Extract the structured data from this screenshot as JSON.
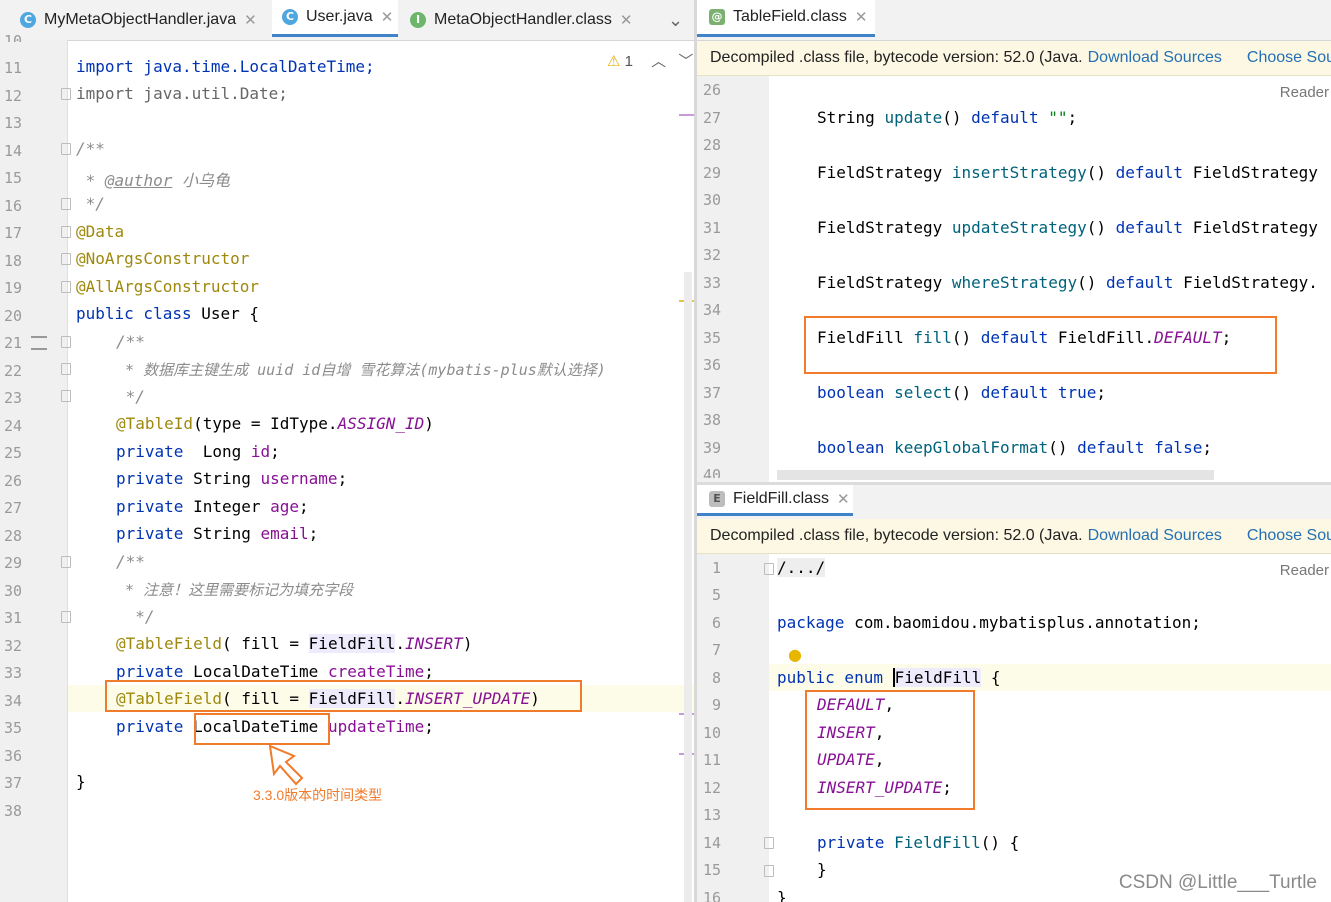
{
  "left": {
    "tabs": [
      {
        "icon": "class-c-icon",
        "label": "MyMetaObjectHandler.java"
      },
      {
        "icon": "class-c-icon",
        "label": "User.java"
      },
      {
        "icon": "interface-i-icon",
        "label": "MetaObjectHandler.class"
      }
    ],
    "warning_count": "1",
    "lines": {
      "l11": "11",
      "l12": "12",
      "l13": "13",
      "l14": "14",
      "l15": "15",
      "l16": "16",
      "l17": "17",
      "l18": "18",
      "l19": "19",
      "l20": "20",
      "l21": "21",
      "l22": "22",
      "l23": "23",
      "l24": "24",
      "l25": "25",
      "l26": "26",
      "l27": "27",
      "l28": "28",
      "l29": "29",
      "l30": "30",
      "l31": "31",
      "l32": "32",
      "l33": "33",
      "l34": "34",
      "l35": "35",
      "l36": "36",
      "l37": "37",
      "l38": "38"
    },
    "code": {
      "import1": "import java.time.LocalDateTime;",
      "import2": "import java.util.Date;",
      "doc_open": "/**",
      "author_prefix": " * ",
      "author_tag": "@author",
      "author_name": " 小乌龟",
      "doc_close": " */",
      "data": "@Data",
      "noargs": "@NoArgsConstructor",
      "allargs": "@AllArgsConstructor",
      "class_kw": "public class",
      "class_name": " User {",
      "c2_open": "/**",
      "c2_line": " * 数据库主键生成 uuid id自增 雪花算法(mybatis-plus默认选择)",
      "c2_close": " */",
      "tableid_ann": "@TableId",
      "tableid_rest": "(type = IdType.",
      "tableid_const": "ASSIGN_ID",
      "tableid_end": ")",
      "f1_kw": "private",
      "f1_type": "  Long ",
      "f1_name": "id",
      "f1_end": ";",
      "f2_kw": "private",
      "f2_type": " String ",
      "f2_name": "username",
      "f2_end": ";",
      "f3_kw": "private",
      "f3_type": " Integer ",
      "f3_name": "age",
      "f3_end": ";",
      "f4_kw": "private",
      "f4_type": " String ",
      "f4_name": "email",
      "f4_end": ";",
      "c3_open": "/**",
      "c3_line": " * 注意！这里需要标记为填充字段",
      "c3_close": "  */",
      "tf1_ann": "@TableField",
      "tf1_mid": "( fill = ",
      "tf1_type": "FieldFill",
      "tf1_dot": ".",
      "tf1_const": "INSERT",
      "tf1_end": ")",
      "f5_kw": "private",
      "f5_type": " LocalDateTime ",
      "f5_name": "createTime",
      "f5_end": ";",
      "tf2_ann": "@TableField",
      "tf2_mid": "( fill = ",
      "tf2_type": "FieldFill",
      "tf2_dot": ".",
      "tf2_const": "INSERT_UPDATE",
      "tf2_end": ")",
      "f6_kw": "private",
      "f6_type": "LocalDateTime",
      "f6_name": " updateTime",
      "f6_end": ";",
      "close": "}"
    },
    "annotation_note": "3.3.0版本的时间类型"
  },
  "right_top": {
    "tab": {
      "icon": "annotation-icon",
      "label": "TableField.class"
    },
    "banner_text": "Decompiled .class file, bytecode version: 52.0 (Java.",
    "download_label": "Download Sources",
    "choose_label": "Choose Sou",
    "reader_label": "Reader",
    "lines": {
      "r26": "26",
      "r27": "27",
      "r28": "28",
      "r29": "29",
      "r30": "30",
      "r31": "31",
      "r32": "32",
      "r33": "33",
      "r34": "34",
      "r35": "35",
      "r36": "36",
      "r37": "37",
      "r38": "38",
      "r39": "39",
      "r40": "40"
    },
    "code": {
      "c27_type": "String ",
      "c27_m": "update",
      "c27_r": "() ",
      "c27_kw": "default",
      "c27_s": " \"\"",
      "c27_e": ";",
      "c29_type": "FieldStrategy ",
      "c29_m": "insertStrategy",
      "c29_r": "() ",
      "c29_kw": "default",
      "c29_e": " FieldStrategy",
      "c31_type": "FieldStrategy ",
      "c31_m": "updateStrategy",
      "c31_r": "() ",
      "c31_kw": "default",
      "c31_e": " FieldStrategy",
      "c33_type": "FieldStrategy ",
      "c33_m": "whereStrategy",
      "c33_r": "() ",
      "c33_kw": "default",
      "c33_e": " FieldStrategy.",
      "c35_type": "FieldFill ",
      "c35_m": "fill",
      "c35_r": "() ",
      "c35_kw": "default",
      "c35_t2": " FieldFill.",
      "c35_const": "DEFAULT",
      "c35_e": ";",
      "c37_kw1": "boolean ",
      "c37_m": "select",
      "c37_r": "() ",
      "c37_kw": "default",
      "c37_v": " true",
      "c37_e": ";",
      "c39_kw1": "boolean ",
      "c39_m": "keepGlobalFormat",
      "c39_r": "() ",
      "c39_kw": "default",
      "c39_v": " false",
      "c39_e": ";"
    }
  },
  "right_bottom": {
    "tab": {
      "icon": "enum-e-icon",
      "label": "FieldFill.class"
    },
    "banner_text": "Decompiled .class file, bytecode version: 52.0 (Java.",
    "download_label": "Download Sources",
    "choose_label": "Choose Sou",
    "reader_label": "Reader",
    "lines": {
      "b1": "1",
      "b5": "5",
      "b6": "6",
      "b7": "7",
      "b8": "8",
      "b9": "9",
      "b10": "10",
      "b11": "11",
      "b12": "12",
      "b13": "13",
      "b14": "14",
      "b15": "15",
      "b16": "16"
    },
    "code": {
      "folded": "/.../",
      "pkg_kw": "package",
      "pkg_name": " com.baomidou.mybatisplus.annotation;",
      "enum_kw": "public enum ",
      "enum_name": "FieldFill",
      "enum_open": " {",
      "v1": "DEFAULT",
      "v1e": ",",
      "v2": "INSERT",
      "v2e": ",",
      "v3": "UPDATE",
      "v3e": ",",
      "v4": "INSERT_UPDATE",
      "v4e": ";",
      "ctor_kw": "private ",
      "ctor_name": "FieldFill",
      "ctor_r": "() {",
      "ctor_close": "}",
      "close": "}"
    }
  },
  "watermark": "CSDN @Little___Turtle"
}
